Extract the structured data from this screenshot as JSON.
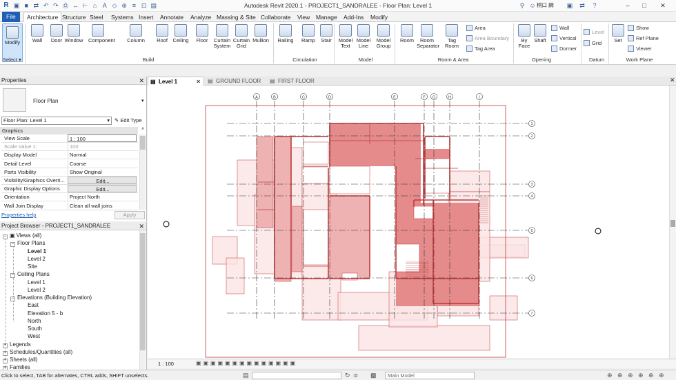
{
  "app": {
    "title": "Autodesk Revit 2020.1 - PROJECT1_SANDRALEE - Floor Plan: Level 1",
    "logo": "R",
    "user": "桐口 網",
    "quick_access_icons": [
      "open-icon",
      "save-icon",
      "sync-icon",
      "undo-icon",
      "redo-icon",
      "print-icon",
      "measure-icon",
      "dimension-icon",
      "tag-icon",
      "text-icon",
      "3d-view-icon",
      "section-icon",
      "thin-lines-icon",
      "close-hidden-icon",
      "switch-windows-icon"
    ]
  },
  "tabs": [
    "File",
    "Architecture",
    "Structure",
    "Steel",
    "Systems",
    "Insert",
    "Annotate",
    "Analyze",
    "Massing & Site",
    "Collaborate",
    "View",
    "Manage",
    "Add-Ins",
    "Modify"
  ],
  "active_tab": "Architecture",
  "ribbon": {
    "modify": "Modify",
    "select": "Select",
    "build": [
      "Wall",
      "Door",
      "Window",
      "Component",
      "Column",
      "Roof",
      "Ceiling",
      "Floor",
      "Curtain System",
      "Curtain Grid",
      "Mullion"
    ],
    "build_label": "Build",
    "circulation": [
      "Railing",
      "Ramp",
      "Stair"
    ],
    "circulation_label": "Circulation",
    "model": [
      "Model Text",
      "Model Line",
      "Model Group"
    ],
    "model_label": "Model",
    "room": [
      "Room",
      "Room Separator",
      "Tag Room"
    ],
    "room_small": [
      "Area",
      "Area Boundary",
      "Tag Area"
    ],
    "room_label": "Room & Area",
    "opening": [
      "By Face",
      "Shaft"
    ],
    "opening_small": [
      "Wall",
      "Vertical",
      "Dormer"
    ],
    "opening_label": "Opening",
    "datum_small": [
      "Level",
      "Grid"
    ],
    "datum_label": "Datum",
    "workplane": [
      "Set"
    ],
    "workplane_small": [
      "Show",
      "Ref Plane",
      "Viewer"
    ],
    "workplane_label": "Work Plane"
  },
  "properties": {
    "header": "Properties",
    "type_name": "Floor Plan",
    "selector": "Floor Plan: Level 1",
    "edit_type": "Edit Type",
    "group": "Graphics",
    "rows": [
      [
        "View Scale",
        "1 : 100"
      ],
      [
        "Scale Value    1:",
        "100"
      ],
      [
        "Display Model",
        "Normal"
      ],
      [
        "Detail Level",
        "Coarse"
      ],
      [
        "Parts Visibility",
        "Show Original"
      ],
      [
        "Visibility/Graphics Overri...",
        "Edit..."
      ],
      [
        "Graphic Display Options",
        "Edit..."
      ],
      [
        "Orientation",
        "Project North"
      ],
      [
        "Wall Join Display",
        "Clean all wall joins"
      ]
    ],
    "help": "Properties help",
    "apply": "Apply"
  },
  "browser": {
    "header": "Project Browser - PROJECT1_SANDRALEE",
    "items": [
      "Views (all)",
      "Floor Plans",
      "Level 1",
      "Level 2",
      "Site",
      "Ceiling Plans",
      "Level 1",
      "Level 2",
      "Elevations (Building Elevation)",
      "East",
      "Elevation 5 - b",
      "North",
      "South",
      "West",
      "Legends",
      "Schedules/Quantities (all)",
      "Sheets (all)",
      "Families"
    ]
  },
  "view_tabs": [
    "Level 1",
    "GROUND FLOOR",
    "FIRST FLOOR"
  ],
  "grid_top": [
    "A",
    "B",
    "C",
    "D",
    "E",
    "F",
    "G",
    "H",
    "I"
  ],
  "grid_side": [
    "1",
    "2",
    "3",
    "4",
    "5",
    "6",
    "7"
  ],
  "view_scale": "1 : 100",
  "status": {
    "hint": "Click to select, TAB for alternates, CTRL adds, SHIFT unselects.",
    "coord": ":0",
    "workset": "Main Model"
  },
  "colors": {
    "accent": "#1f5fb4",
    "plan_line": "#c0393b",
    "fill_dark": "#e58b8b",
    "fill_mid": "#eeb2b2",
    "fill_light": "#fbe3e3"
  }
}
